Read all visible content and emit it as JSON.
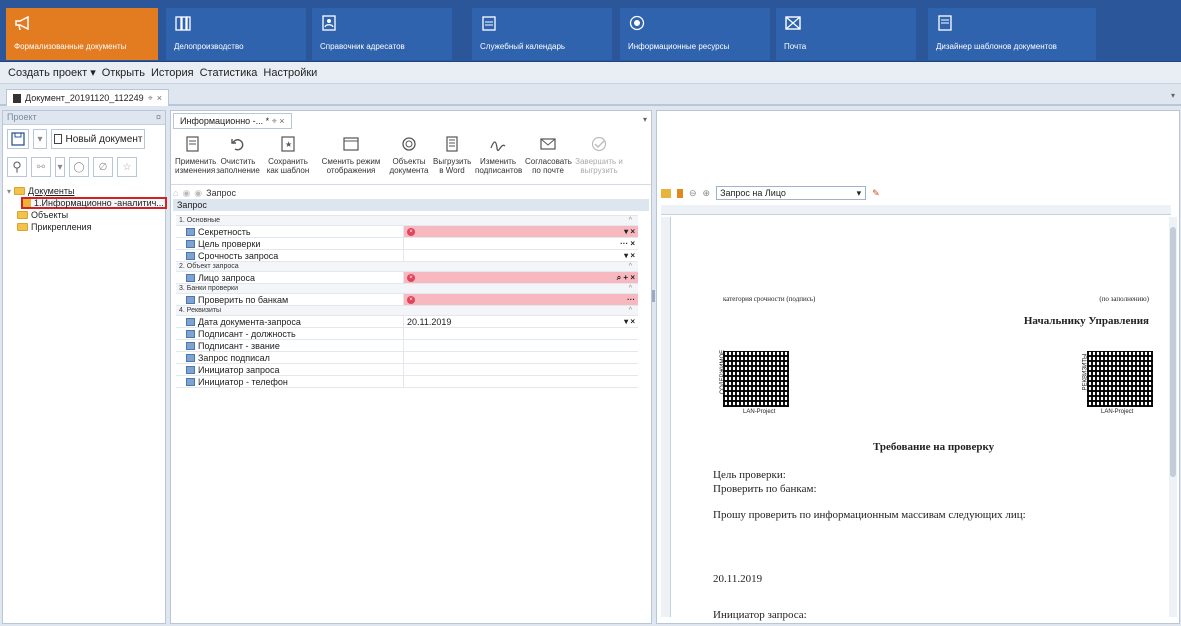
{
  "modules": [
    {
      "label": "Формализованные документы",
      "icon": "megaphone-icon",
      "active": true
    },
    {
      "label": "Делопроизводство",
      "icon": "archive-icon"
    },
    {
      "label": "Справочник адресатов",
      "icon": "contacts-icon"
    },
    {
      "label": "Служебный календарь",
      "icon": "calendar-icon"
    },
    {
      "label": "Информационные ресурсы",
      "icon": "globe-icon"
    },
    {
      "label": "Почта",
      "icon": "mail-icon"
    },
    {
      "label": "Дизайнер шаблонов документов",
      "icon": "template-icon"
    }
  ],
  "menu": [
    "Создать проект ▾",
    "Открыть",
    "История",
    "Статистика",
    "Настройки"
  ],
  "doc_tab": {
    "label": "Документ_20191120_112249",
    "pin": "⌖",
    "close": "×"
  },
  "project_panel": {
    "title": "Проект",
    "pin": "¤",
    "new_doc_label": "Новый документ",
    "tree": {
      "root": "Документы",
      "selected": "1.Информационно -аналитич...",
      "items": [
        "Объекты",
        "Прикрепления"
      ]
    }
  },
  "editor": {
    "tab_label": "Информационно -... *",
    "ribbon": [
      {
        "label1": "Применить",
        "label2": "изменения"
      },
      {
        "label1": "Очистить",
        "label2": "заполнение"
      },
      {
        "label1": "Сохранить",
        "label2": "как шаблон"
      },
      {
        "label1": "Сменить режим",
        "label2": "отображения"
      },
      {
        "label1": "Объекты",
        "label2": "документа"
      },
      {
        "label1": "Выгрузить",
        "label2": "в Word"
      },
      {
        "label1": "Изменить",
        "label2": "подписантов"
      },
      {
        "label1": "Согласовать",
        "label2": "по почте"
      },
      {
        "label1": "Завершить и",
        "label2": "выгрузить",
        "disabled": true
      }
    ],
    "crumb": "Запрос",
    "section": "Запрос",
    "groups": [
      {
        "title": "1. Основные",
        "rows": [
          {
            "name": "Секретность",
            "value": "",
            "required": true,
            "ctrl": "▾ ×"
          },
          {
            "name": "Цель проверки",
            "value": "",
            "ctrl": "··· ×"
          },
          {
            "name": "Срочность запроса",
            "value": "",
            "ctrl": "▾ ×"
          }
        ]
      },
      {
        "title": "2. Объект запроса",
        "rows": [
          {
            "name": "Лицо запроса",
            "value": "",
            "required": true,
            "ctrl": "⌕ + ×"
          }
        ]
      },
      {
        "title": "3. Банки проверки",
        "rows": [
          {
            "name": "Проверить по банкам",
            "value": "",
            "required": true,
            "ctrl": "···"
          }
        ]
      },
      {
        "title": "4. Реквизиты",
        "rows": [
          {
            "name": "Дата документа-запроса",
            "value": "20.11.2019",
            "ctrl": "▾ ×"
          },
          {
            "name": "Подписант - должность",
            "value": "",
            "ctrl": ""
          },
          {
            "name": "Подписант - звание",
            "value": "",
            "ctrl": ""
          },
          {
            "name": "Запрос подписал",
            "value": "",
            "ctrl": ""
          },
          {
            "name": "Инициатор запроса",
            "value": "",
            "ctrl": ""
          },
          {
            "name": "Инициатор - телефон",
            "value": "",
            "ctrl": ""
          }
        ]
      }
    ]
  },
  "preview": {
    "selector": "Запрос на Лицо",
    "page": {
      "line1_left": "категория срочности (подпись)",
      "line1_right": "(по заполнению)",
      "addressee": "Начальнику Управления",
      "qr_left_caption": "LAN-Project",
      "qr_right_caption": "LAN-Project",
      "qr_left_side": "СОДЕРЖИМОЕ",
      "qr_right_side": "РЕКВИЗИТЫ",
      "heading": "Требование на проверку",
      "purpose": "Цель проверки:",
      "banks": "Проверить по банкам:",
      "request": "Прошу проверить по информационным массивам следующих лиц:",
      "date": "20.11.2019",
      "initiator": "Инициатор запроса:"
    }
  },
  "colors": {
    "topbar": "#2b579a",
    "active_module": "#e37b21",
    "required": "#f7b8c0",
    "error": "#e0455b"
  }
}
